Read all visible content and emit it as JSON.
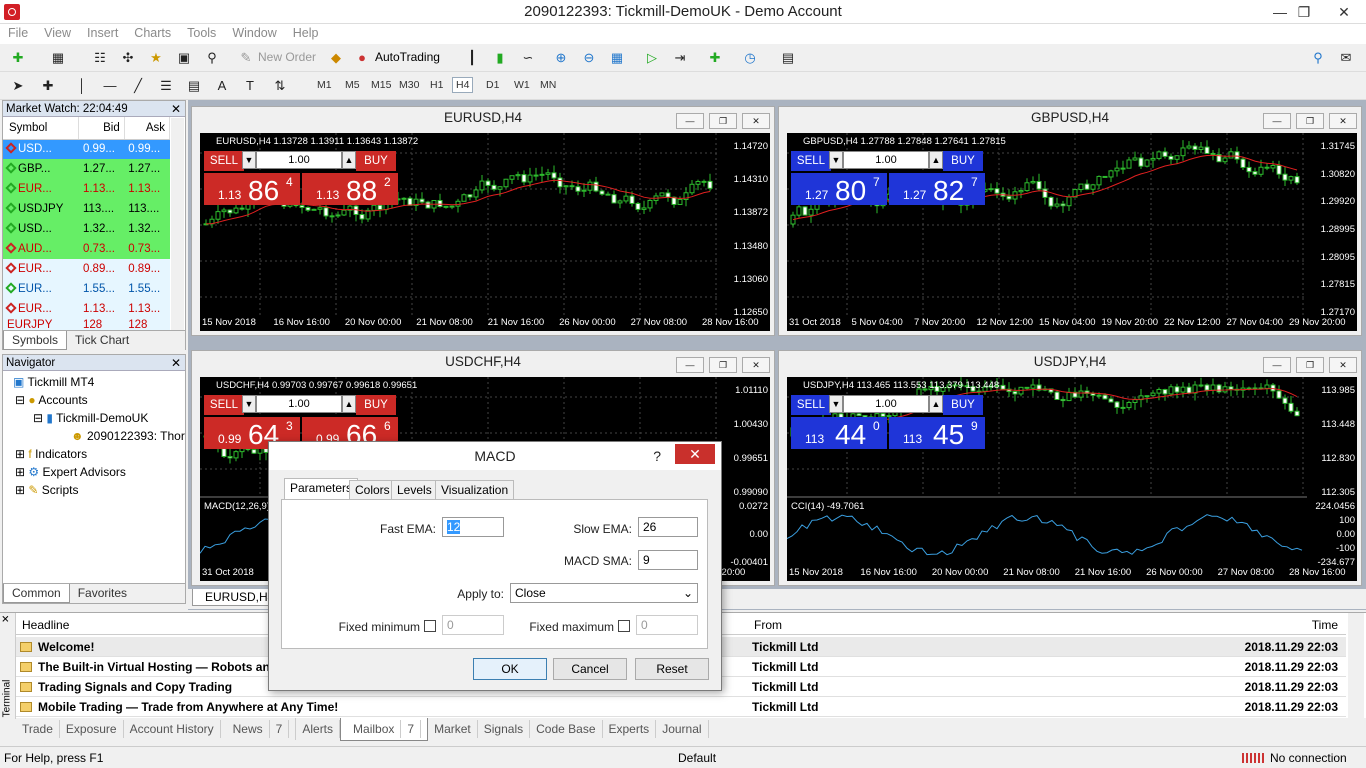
{
  "window": {
    "title": "2090122393: Tickmill-DemoUK - Demo Account"
  },
  "menu": [
    "File",
    "View",
    "Insert",
    "Charts",
    "Tools",
    "Window",
    "Help"
  ],
  "toolbar": {
    "new_order": "New Order",
    "autotrading": "AutoTrading"
  },
  "timeframes": [
    "M1",
    "M5",
    "M15",
    "M30",
    "H1",
    "H4",
    "D1",
    "W1",
    "MN"
  ],
  "market_watch": {
    "title": "Market Watch: 22:04:49",
    "headers": [
      "Symbol",
      "Bid",
      "Ask"
    ],
    "rows": [
      {
        "symbol": "USD...",
        "bid": "0.99...",
        "ask": "0.99..."
      },
      {
        "symbol": "GBP...",
        "bid": "1.27...",
        "ask": "1.27..."
      },
      {
        "symbol": "EUR...",
        "bid": "1.13...",
        "ask": "1.13..."
      },
      {
        "symbol": "USDJPY",
        "bid": "113....",
        "ask": "113...."
      },
      {
        "symbol": "USD...",
        "bid": "1.32...",
        "ask": "1.32..."
      },
      {
        "symbol": "AUD...",
        "bid": "0.73...",
        "ask": "0.73..."
      },
      {
        "symbol": "EUR...",
        "bid": "0.89...",
        "ask": "0.89..."
      },
      {
        "symbol": "EUR...",
        "bid": "1.55...",
        "ask": "1.55..."
      },
      {
        "symbol": "EUR...",
        "bid": "1.13...",
        "ask": "1.13..."
      },
      {
        "symbol": "EURJPY",
        "bid": "128",
        "ask": "128"
      }
    ],
    "tabs": [
      "Symbols",
      "Tick Chart"
    ]
  },
  "navigator": {
    "title": "Navigator",
    "items": [
      "Tickmill MT4",
      "Accounts",
      "Tickmill-DemoUK",
      "2090122393: Thor",
      "Indicators",
      "Expert Advisors",
      "Scripts"
    ],
    "tabs": [
      "Common",
      "Favorites"
    ]
  },
  "charts": [
    {
      "title": "EURUSD,H4",
      "info": "EURUSD,H4  1.13728 1.13911 1.13643 1.13872",
      "sell": "SELL",
      "buy": "BUY",
      "lot": "1.00",
      "sell_price": {
        "small": "1.13",
        "big": "86",
        "pip": "4"
      },
      "buy_price": {
        "small": "1.13",
        "big": "88",
        "pip": "2"
      },
      "prices": [
        "1.14720",
        "1.14310",
        "1.13872",
        "1.13480",
        "1.13060",
        "1.12650"
      ],
      "dates": [
        "15 Nov 2018",
        "16 Nov 16:00",
        "20 Nov 00:00",
        "21 Nov 08:00",
        "21 Nov 16:00",
        "26 Nov 00:00",
        "27 Nov 08:00",
        "28 Nov 16:00"
      ]
    },
    {
      "title": "GBPUSD,H4",
      "info": "GBPUSD,H4  1.27788 1.27848 1.27641 1.27815",
      "sell": "SELL",
      "buy": "BUY",
      "lot": "1.00",
      "sell_price": {
        "small": "1.27",
        "big": "80",
        "pip": "7"
      },
      "buy_price": {
        "small": "1.27",
        "big": "82",
        "pip": "7"
      },
      "prices": [
        "1.31745",
        "1.30820",
        "1.29920",
        "1.28995",
        "1.28095",
        "1.27815",
        "1.27170"
      ],
      "dates": [
        "31 Oct 2018",
        "5 Nov 04:00",
        "7 Nov 20:00",
        "12 Nov 12:00",
        "15 Nov 04:00",
        "19 Nov 20:00",
        "22 Nov 12:00",
        "27 Nov 04:00",
        "29 Nov 20:00"
      ]
    },
    {
      "title": "USDCHF,H4",
      "info": "USDCHF,H4  0.99703 0.99767 0.99618 0.99651",
      "sell": "SELL",
      "buy": "BUY",
      "lot": "1.00",
      "sell_price": {
        "small": "0.99",
        "big": "64",
        "pip": "3"
      },
      "buy_price": {
        "small": "0.99",
        "big": "66",
        "pip": "6"
      },
      "prices": [
        "1.01110",
        "1.00430",
        "0.99651",
        "0.99090"
      ],
      "sub_label": "MACD(12,26,9)",
      "sub_prices": [
        "0.0272",
        "0.00",
        "-0.00401"
      ],
      "dates": [
        "31 Oct 2018",
        "Nov 20:00"
      ]
    },
    {
      "title": "USDJPY,H4",
      "info": "USDJPY,H4  113.465 113.553 113.379 113.448",
      "sell": "SELL",
      "buy": "BUY",
      "lot": "1.00",
      "sell_price": {
        "small": "113",
        "big": "44",
        "pip": "0"
      },
      "buy_price": {
        "small": "113",
        "big": "45",
        "pip": "9"
      },
      "prices": [
        "113.985",
        "113.448",
        "112.830",
        "112.305"
      ],
      "sub_label": "CCI(14) -49.7061",
      "sub_prices": [
        "224.0456",
        "100",
        "0.00",
        "-100",
        "-234.677"
      ],
      "dates": [
        "15 Nov 2018",
        "16 Nov 16:00",
        "20 Nov 00:00",
        "21 Nov 08:00",
        "21 Nov 16:00",
        "26 Nov 00:00",
        "27 Nov 08:00",
        "28 Nov 16:00"
      ]
    }
  ],
  "chart_tab": "EURUSD,H4",
  "dialog": {
    "title": "MACD",
    "help": "?",
    "tabs": [
      "Parameters",
      "Colors",
      "Levels",
      "Visualization"
    ],
    "fast_ema_label": "Fast EMA:",
    "fast_ema": "12",
    "slow_ema_label": "Slow EMA:",
    "slow_ema": "26",
    "macd_sma_label": "MACD SMA:",
    "macd_sma": "9",
    "apply_to_label": "Apply to:",
    "apply_to": "Close",
    "fixed_min_label": "Fixed minimum",
    "fixed_min": "0",
    "fixed_max_label": "Fixed maximum",
    "fixed_max": "0",
    "ok": "OK",
    "cancel": "Cancel",
    "reset": "Reset"
  },
  "terminal": {
    "side_label": "Terminal",
    "headers": [
      "Headline",
      "From",
      "Time"
    ],
    "rows": [
      {
        "headline": "Welcome!",
        "from": "Tickmill Ltd",
        "time": "2018.11.29 22:03"
      },
      {
        "headline": "The Built-in Virtual Hosting — Robots and",
        "from": "Tickmill Ltd",
        "time": "2018.11.29 22:03"
      },
      {
        "headline": "Trading Signals and Copy Trading",
        "from": "Tickmill Ltd",
        "time": "2018.11.29 22:03"
      },
      {
        "headline": "Mobile Trading — Trade from Anywhere at Any Time!",
        "from": "Tickmill Ltd",
        "time": "2018.11.29 22:03"
      }
    ],
    "tabs": [
      "Trade",
      "Exposure",
      "Account History",
      "News",
      "Alerts",
      "Mailbox",
      "Market",
      "Signals",
      "Code Base",
      "Experts",
      "Journal"
    ],
    "news_count": "7",
    "mailbox_count": "7"
  },
  "status": {
    "help": "For Help, press F1",
    "profile": "Default",
    "connection": "No connection"
  }
}
